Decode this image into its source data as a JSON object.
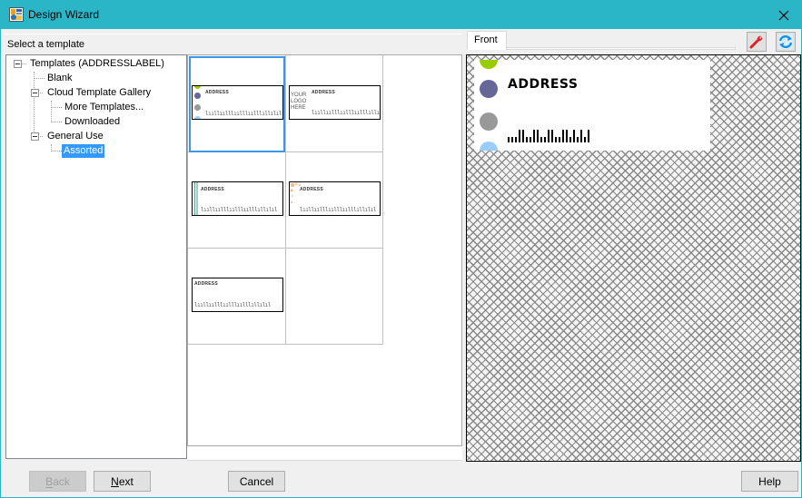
{
  "window": {
    "title": "Design Wizard",
    "app_icon": "design-wizard-app-icon",
    "close_icon": "close-icon"
  },
  "template_selector": {
    "header_label": "Select a template"
  },
  "tree": {
    "items": [
      {
        "label": "Templates (ADDRESSLABEL)",
        "level": 0,
        "expanded": true,
        "selected": false
      },
      {
        "label": "Blank",
        "level": 1,
        "expanded": null,
        "selected": false
      },
      {
        "label": "Cloud Template Gallery",
        "level": 1,
        "expanded": true,
        "selected": false
      },
      {
        "label": "More Templates...",
        "level": 2,
        "expanded": null,
        "selected": false
      },
      {
        "label": "Downloaded",
        "level": 2,
        "expanded": null,
        "selected": false
      },
      {
        "label": "General Use",
        "level": 1,
        "expanded": true,
        "selected": false
      },
      {
        "label": "Assorted",
        "level": 2,
        "expanded": null,
        "selected": true
      }
    ]
  },
  "gallery": {
    "thumbnails": [
      {
        "name": "dots-template",
        "address_text": "ADDRESS",
        "selected": true
      },
      {
        "name": "logo-template",
        "address_text": "ADDRESS",
        "logo_text": [
          "YOUR",
          "LOGO",
          "HERE"
        ],
        "selected": false
      },
      {
        "name": "stripe-template",
        "address_text": "ADDRESS",
        "selected": false
      },
      {
        "name": "floral-corner-template",
        "address_text": "ADDRESS",
        "selected": false
      },
      {
        "name": "plain-template",
        "address_text": "ADDRESS",
        "selected": false
      }
    ],
    "barcode_text": "lııllıılllıılllıılllıllılıl"
  },
  "preview": {
    "tabs": [
      {
        "label": "Front",
        "active": true
      }
    ],
    "tools": [
      {
        "name": "wrench-icon",
        "tooltip": ""
      },
      {
        "name": "refresh-icon",
        "tooltip": ""
      }
    ],
    "label": {
      "address_text": "ADDRESS",
      "dot_colors": [
        "#99cc00",
        "#666699",
        "#999999",
        "#99ccff"
      ]
    }
  },
  "buttons": {
    "back": {
      "label": "Back",
      "mnemonic": "B",
      "enabled": false
    },
    "next": {
      "label": "Next",
      "mnemonic": "N",
      "enabled": true
    },
    "cancel": {
      "label": "Cancel",
      "enabled": true
    },
    "help": {
      "label": "Help",
      "enabled": true
    }
  },
  "colors": {
    "titlebar": "#2bb6c8",
    "selection": "#3399ff",
    "selected_thumb_border": "#3d97e8"
  }
}
